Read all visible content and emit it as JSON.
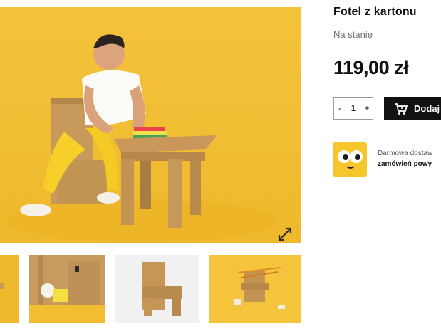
{
  "product": {
    "title": "Fotel z kartonu",
    "stock_status": "Na stanie",
    "price": "119,00 zł",
    "quantity": {
      "minus_label": "-",
      "value": "1",
      "plus_label": "+"
    },
    "add_to_cart_label": "Dodaj",
    "shipping": {
      "line1": "Darmowa dostaw",
      "line2": "zamówień powy"
    }
  },
  "gallery": {
    "icons": {
      "expand": "expand-arrows-icon",
      "cart": "cart-add-icon"
    }
  },
  "colors": {
    "accent_yellow": "#f2bd33",
    "button_black": "#111111",
    "muted_text": "#6f6f6f"
  }
}
